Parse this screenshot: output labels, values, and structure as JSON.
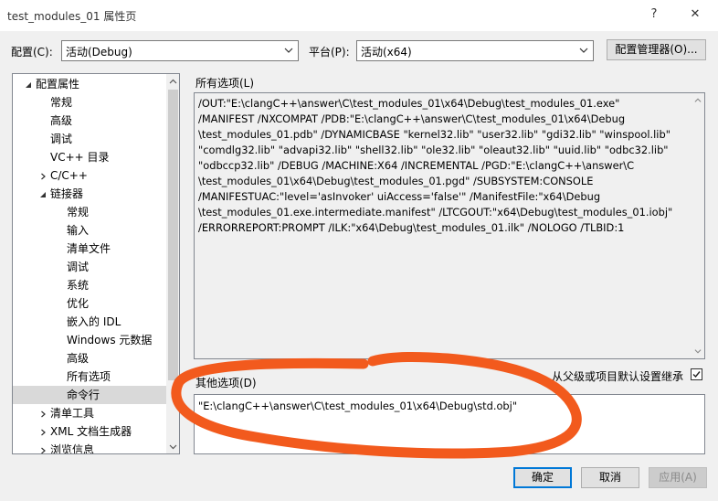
{
  "window": {
    "title": "test_modules_01 属性页",
    "help": "?",
    "close": "✕"
  },
  "config": {
    "label": "配置(C):",
    "value": "活动(Debug)"
  },
  "platform": {
    "label": "平台(P):",
    "value": "活动(x64)"
  },
  "config_manager": {
    "label": "配置管理器(O)..."
  },
  "tree": {
    "items": [
      {
        "label": "配置属性",
        "level": 0,
        "expander": "down"
      },
      {
        "label": "常规",
        "level": 1,
        "expander": "none"
      },
      {
        "label": "高级",
        "level": 1,
        "expander": "none"
      },
      {
        "label": "调试",
        "level": 1,
        "expander": "none"
      },
      {
        "label": "VC++ 目录",
        "level": 1,
        "expander": "none"
      },
      {
        "label": "C/C++",
        "level": 1,
        "expander": "right"
      },
      {
        "label": "链接器",
        "level": 1,
        "expander": "down"
      },
      {
        "label": "常规",
        "level": 2,
        "expander": "none"
      },
      {
        "label": "输入",
        "level": 2,
        "expander": "none"
      },
      {
        "label": "清单文件",
        "level": 2,
        "expander": "none"
      },
      {
        "label": "调试",
        "level": 2,
        "expander": "none"
      },
      {
        "label": "系统",
        "level": 2,
        "expander": "none"
      },
      {
        "label": "优化",
        "level": 2,
        "expander": "none"
      },
      {
        "label": "嵌入的 IDL",
        "level": 2,
        "expander": "none"
      },
      {
        "label": "Windows 元数据",
        "level": 2,
        "expander": "none"
      },
      {
        "label": "高级",
        "level": 2,
        "expander": "none"
      },
      {
        "label": "所有选项",
        "level": 2,
        "expander": "none"
      },
      {
        "label": "命令行",
        "level": 2,
        "expander": "none",
        "selected": true
      },
      {
        "label": "清单工具",
        "level": 1,
        "expander": "right"
      },
      {
        "label": "XML 文档生成器",
        "level": 1,
        "expander": "right"
      },
      {
        "label": "浏览信息",
        "level": 1,
        "expander": "right"
      }
    ]
  },
  "all_options": {
    "label": "所有选项(L)",
    "lines": [
      "/OUT:\"E:\\clangC++\\answer\\C\\test_modules_01\\x64\\Debug\\test_modules_01.exe\"",
      "/MANIFEST /NXCOMPAT /PDB:\"E:\\clangC++\\answer\\C\\test_modules_01\\x64\\Debug",
      "\\test_modules_01.pdb\" /DYNAMICBASE \"kernel32.lib\" \"user32.lib\" \"gdi32.lib\" \"winspool.lib\"",
      "\"comdlg32.lib\" \"advapi32.lib\" \"shell32.lib\" \"ole32.lib\" \"oleaut32.lib\" \"uuid.lib\" \"odbc32.lib\"",
      "\"odbccp32.lib\" /DEBUG /MACHINE:X64 /INCREMENTAL /PGD:\"E:\\clangC++\\answer\\C",
      "\\test_modules_01\\x64\\Debug\\test_modules_01.pgd\" /SUBSYSTEM:CONSOLE",
      "/MANIFESTUAC:\"level='asInvoker' uiAccess='false'\" /ManifestFile:\"x64\\Debug",
      "\\test_modules_01.exe.intermediate.manifest\" /LTCGOUT:\"x64\\Debug\\test_modules_01.iobj\"",
      "/ERRORREPORT:PROMPT /ILK:\"x64\\Debug\\test_modules_01.ilk\" /NOLOGO /TLBID:1"
    ]
  },
  "other_options": {
    "label": "其他选项(D)",
    "value": "\"E:\\clangC++\\answer\\C\\test_modules_01\\x64\\Debug\\std.obj\""
  },
  "inherit": {
    "label": "从父级或项目默认设置继承",
    "checked": true
  },
  "buttons": {
    "ok": "确定",
    "cancel": "取消",
    "apply": "应用(A)"
  },
  "colors": {
    "annotation": "#f25a1d",
    "focus": "#0078d7"
  }
}
